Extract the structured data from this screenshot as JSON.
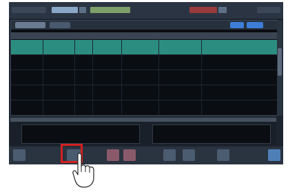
{
  "colors": {
    "screen_bg": "#1c2430",
    "selected_row": "#2b8d7f",
    "highlight": "#d42020",
    "accent_button": "#3d7dd8"
  },
  "icons": {
    "pointer": "hand-pointer-icon"
  },
  "list": {
    "rows": [
      {
        "state": "selected"
      },
      {
        "state": "normal"
      },
      {
        "state": "normal"
      },
      {
        "state": "normal"
      },
      {
        "state": "normal"
      }
    ]
  }
}
